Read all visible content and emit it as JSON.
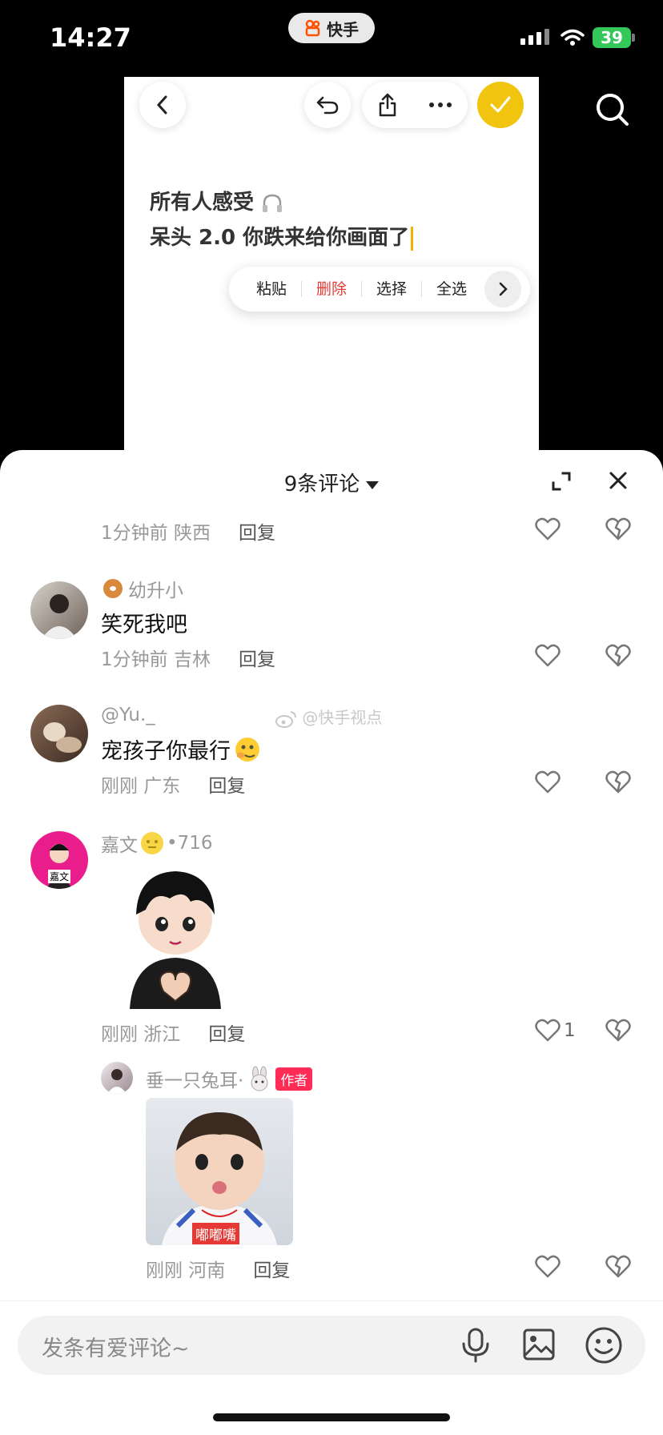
{
  "status_bar": {
    "time": "14:27",
    "app_label": "快手",
    "battery": "39"
  },
  "note": {
    "line1": "所有人感受",
    "line2": "呆头 2.0 你跌来给你画面了"
  },
  "context_menu": [
    "粘贴",
    "删除",
    "选择",
    "全选"
  ],
  "sheet": {
    "title": "9条评论"
  },
  "watermark": "@快手视点",
  "comments": [
    {
      "meta": "1分钟前 陕西",
      "reply": "回复"
    },
    {
      "name": "幼升小",
      "text": "笑死我吧",
      "meta": "1分钟前 吉林",
      "reply": "回复"
    },
    {
      "name": "@Yu._",
      "text": "宠孩子你最行",
      "meta": "刚刚 广东",
      "reply": "回复"
    },
    {
      "name": "嘉文",
      "name_suffix": "•716",
      "avatar_text": "嘉文",
      "meta": "刚刚 浙江",
      "reply": "回复",
      "likes": "1"
    },
    {
      "name": "垂一只兔耳·",
      "author_tag": "作者",
      "sticker_caption": "嘟嘟嘴",
      "meta": "刚刚 河南",
      "reply": "回复"
    }
  ],
  "input": {
    "placeholder": "发条有爱评论~"
  },
  "colors": {
    "accent": "#f1c40f",
    "delete": "#e53935",
    "author_tag": "#ff2d55"
  }
}
